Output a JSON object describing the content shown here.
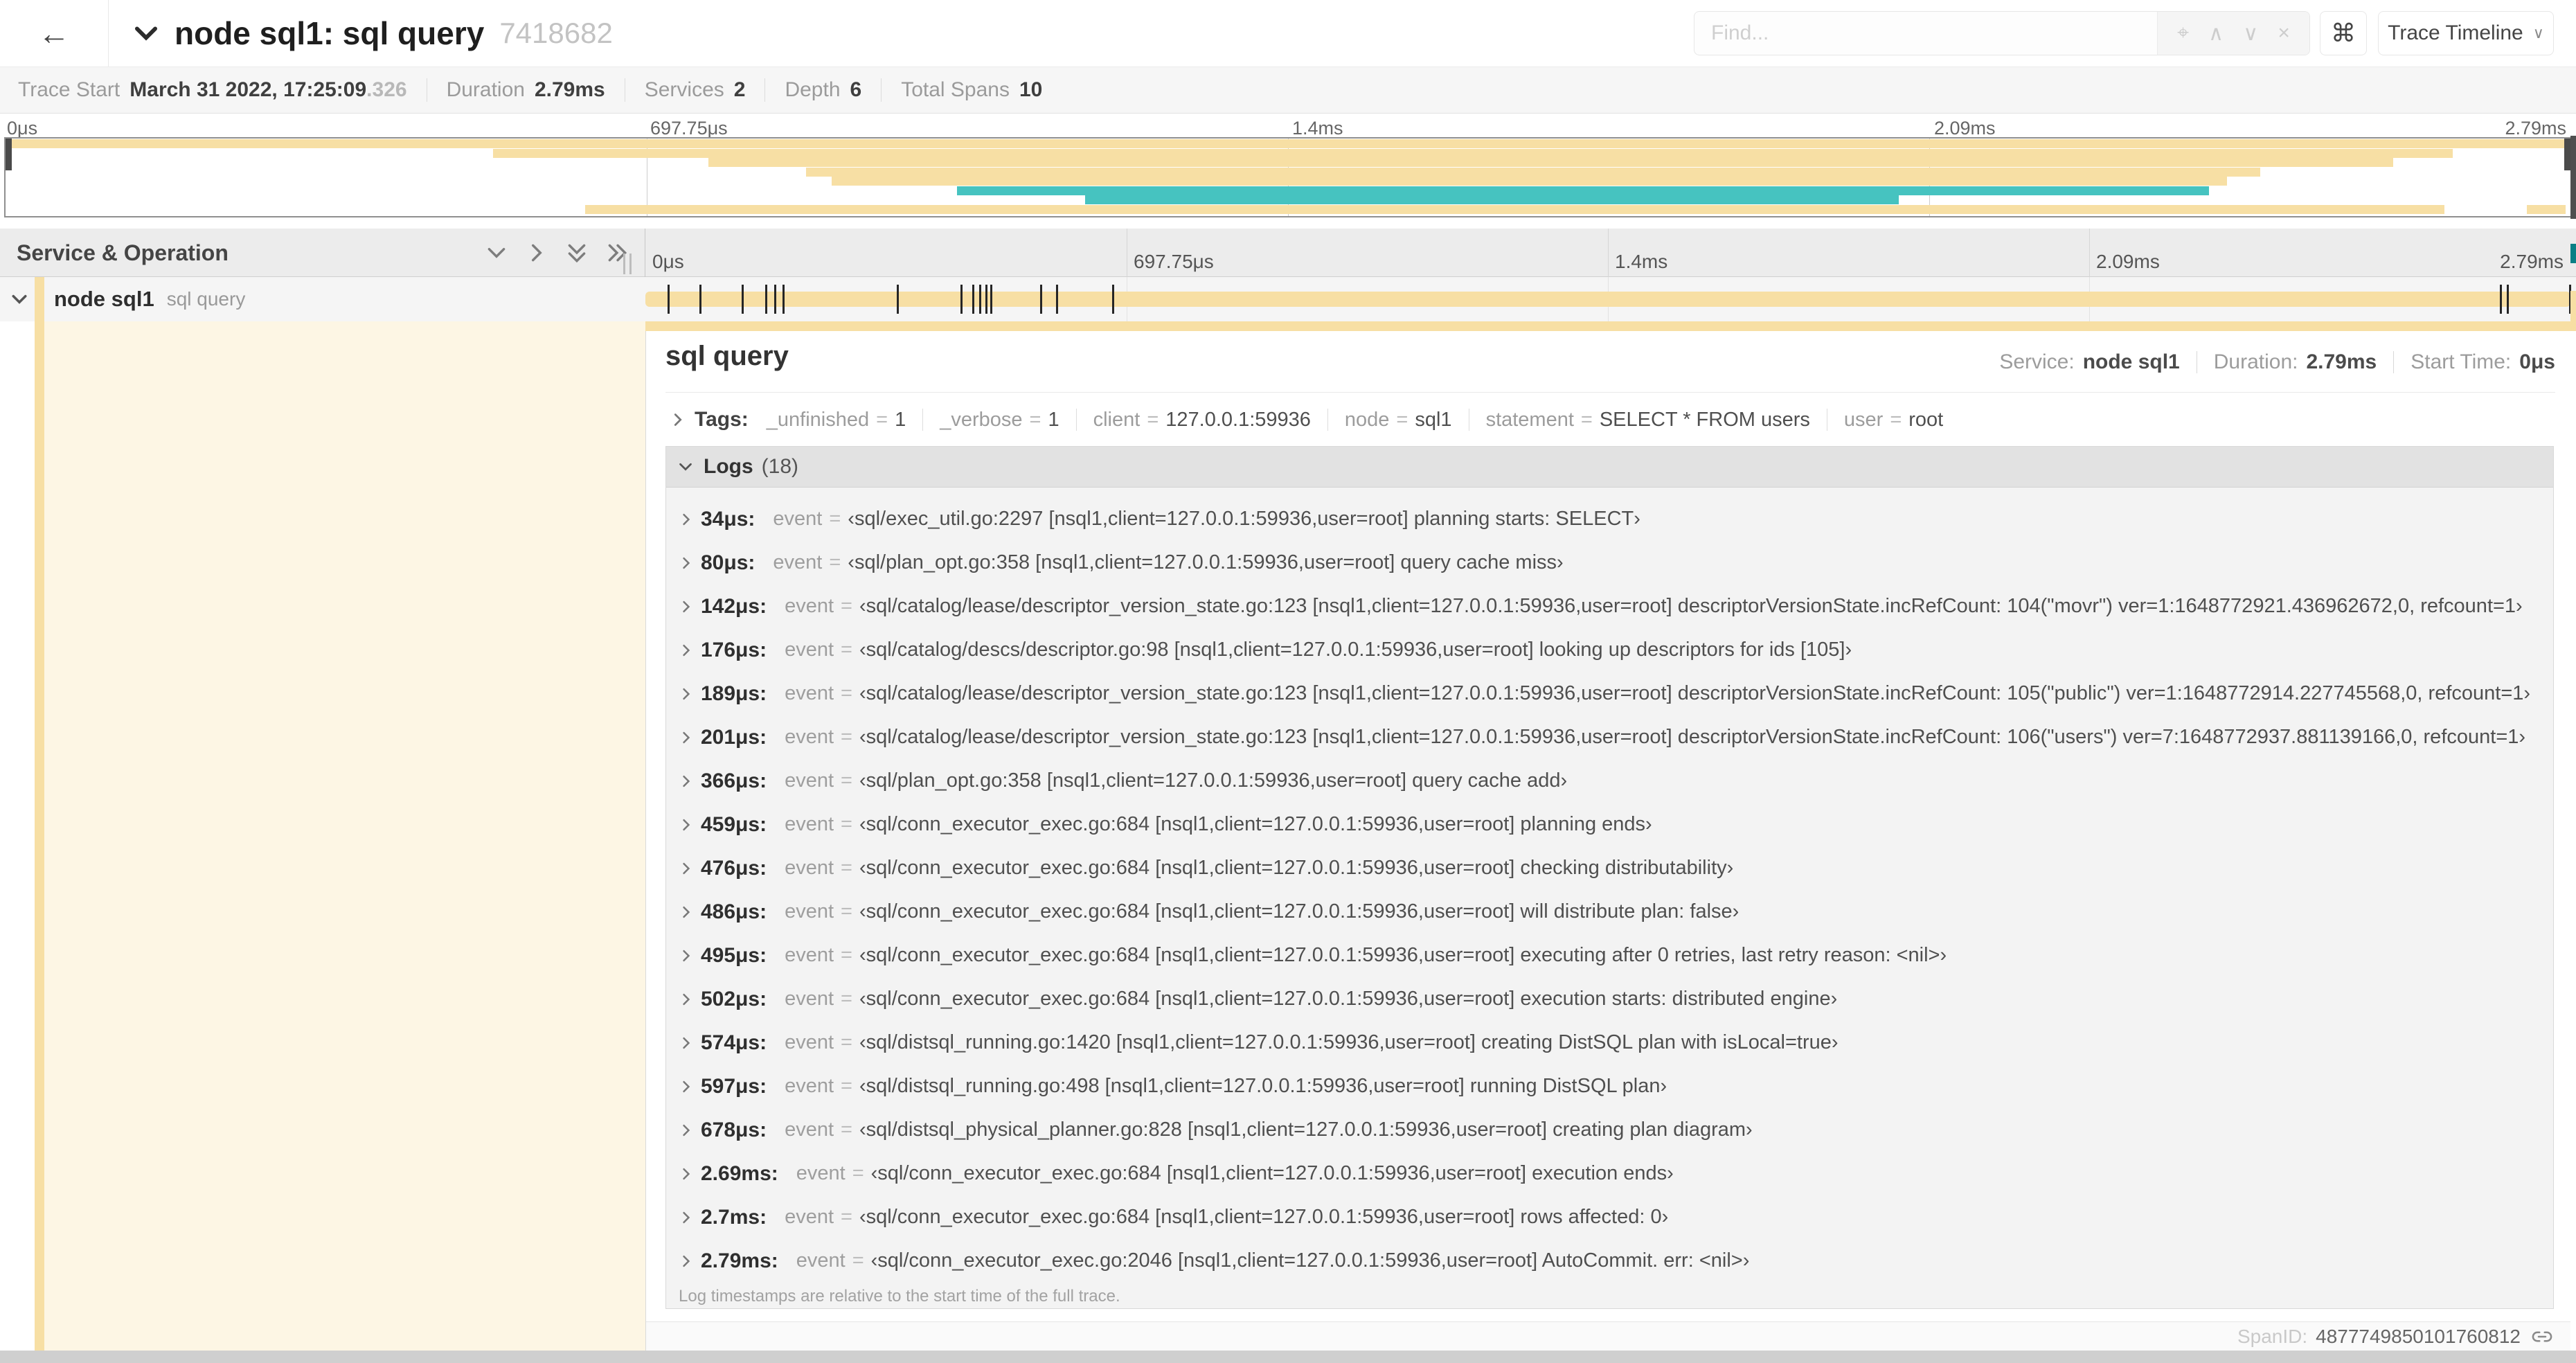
{
  "colors": {
    "tan": "#f7dfa4",
    "teal": "#46c3c0",
    "cream": "#fdf6e4",
    "scrubber": "#4a4a4a",
    "tick": "#262626"
  },
  "header": {
    "back_icon": "←",
    "collapse_icon": "∨",
    "title": "node sql1: sql query",
    "trace_id": "7418682",
    "find_placeholder": "Find...",
    "find_icons": {
      "locate": "⌖",
      "prev": "∧",
      "next": "∨",
      "clear": "×"
    },
    "shortcut_button": "⌘",
    "view_selector": "Trace Timeline",
    "view_selector_chevron": "∨"
  },
  "meta": {
    "items": [
      {
        "label": "Trace Start",
        "value": "March 31 2022, 17:25:09",
        "suffix": ".326"
      },
      {
        "label": "Duration",
        "value": "2.79ms"
      },
      {
        "label": "Services",
        "value": "2"
      },
      {
        "label": "Depth",
        "value": "6"
      },
      {
        "label": "Total Spans",
        "value": "10"
      }
    ]
  },
  "ruler": {
    "labels": [
      "0μs",
      "697.75μs",
      "1.4ms",
      "2.09ms",
      "2.79ms"
    ],
    "fractions": [
      0,
      0.25,
      0.5,
      0.75,
      1
    ]
  },
  "minimap": {
    "bars": [
      {
        "row": 0,
        "start": 0,
        "end": 1,
        "color": "tan"
      },
      {
        "row": 1,
        "start": 0.19,
        "end": 0.954,
        "color": "tan"
      },
      {
        "row": 2,
        "start": 0.274,
        "end": 0.931,
        "color": "tan"
      },
      {
        "row": 3,
        "start": 0.312,
        "end": 0.879,
        "color": "tan"
      },
      {
        "row": 4,
        "start": 0.322,
        "end": 0.866,
        "color": "tan"
      },
      {
        "row": 5,
        "start": 0.371,
        "end": 0.859,
        "color": "teal"
      },
      {
        "row": 6,
        "start": 0.421,
        "end": 0.738,
        "color": "teal"
      },
      {
        "row": 7,
        "start": 0.226,
        "end": 0.951,
        "color": "tan"
      },
      {
        "row": 7,
        "start": 0.983,
        "end": 0.998,
        "color": "tan"
      }
    ]
  },
  "timeline": {
    "left_header": "Service & Operation",
    "row": {
      "service": "node sql1",
      "operation": "sql query",
      "total_us": 2790,
      "tick_times_us": [
        34,
        80,
        142,
        176,
        189,
        201,
        366,
        459,
        476,
        486,
        495,
        502,
        574,
        597,
        678,
        2690,
        2700,
        2790
      ]
    }
  },
  "detail": {
    "title": "sql query",
    "service_label": "Service:",
    "service": "node sql1",
    "duration_label": "Duration:",
    "duration": "2.79ms",
    "start_label": "Start Time:",
    "start": "0μs",
    "tags_label": "Tags:",
    "tags": [
      {
        "key": "_unfinished",
        "value": "1"
      },
      {
        "key": "_verbose",
        "value": "1"
      },
      {
        "key": "client",
        "value": "127.0.0.1:59936"
      },
      {
        "key": "node",
        "value": "sql1"
      },
      {
        "key": "statement",
        "value": "SELECT * FROM users"
      },
      {
        "key": "user",
        "value": "root"
      }
    ],
    "logs_label": "Logs",
    "logs_count": "(18)",
    "logs": [
      {
        "time": "34μs:",
        "field": "event",
        "value": "‹sql/exec_util.go:2297 [nsql1,client=127.0.0.1:59936,user=root] planning starts: SELECT›"
      },
      {
        "time": "80μs:",
        "field": "event",
        "value": "‹sql/plan_opt.go:358 [nsql1,client=127.0.0.1:59936,user=root] query cache miss›"
      },
      {
        "time": "142μs:",
        "field": "event",
        "value": "‹sql/catalog/lease/descriptor_version_state.go:123 [nsql1,client=127.0.0.1:59936,user=root] descriptorVersionState.incRefCount: 104(\"movr\") ver=1:1648772921.436962672,0, refcount=1›"
      },
      {
        "time": "176μs:",
        "field": "event",
        "value": "‹sql/catalog/descs/descriptor.go:98 [nsql1,client=127.0.0.1:59936,user=root] looking up descriptors for ids [105]›"
      },
      {
        "time": "189μs:",
        "field": "event",
        "value": "‹sql/catalog/lease/descriptor_version_state.go:123 [nsql1,client=127.0.0.1:59936,user=root] descriptorVersionState.incRefCount: 105(\"public\") ver=1:1648772914.227745568,0, refcount=1›"
      },
      {
        "time": "201μs:",
        "field": "event",
        "value": "‹sql/catalog/lease/descriptor_version_state.go:123 [nsql1,client=127.0.0.1:59936,user=root] descriptorVersionState.incRefCount: 106(\"users\") ver=7:1648772937.881139166,0, refcount=1›"
      },
      {
        "time": "366μs:",
        "field": "event",
        "value": "‹sql/plan_opt.go:358 [nsql1,client=127.0.0.1:59936,user=root] query cache add›"
      },
      {
        "time": "459μs:",
        "field": "event",
        "value": "‹sql/conn_executor_exec.go:684 [nsql1,client=127.0.0.1:59936,user=root] planning ends›"
      },
      {
        "time": "476μs:",
        "field": "event",
        "value": "‹sql/conn_executor_exec.go:684 [nsql1,client=127.0.0.1:59936,user=root] checking distributability›"
      },
      {
        "time": "486μs:",
        "field": "event",
        "value": "‹sql/conn_executor_exec.go:684 [nsql1,client=127.0.0.1:59936,user=root] will distribute plan: false›"
      },
      {
        "time": "495μs:",
        "field": "event",
        "value": "‹sql/conn_executor_exec.go:684 [nsql1,client=127.0.0.1:59936,user=root] executing after 0 retries, last retry reason: <nil>›"
      },
      {
        "time": "502μs:",
        "field": "event",
        "value": "‹sql/conn_executor_exec.go:684 [nsql1,client=127.0.0.1:59936,user=root] execution starts: distributed engine›"
      },
      {
        "time": "574μs:",
        "field": "event",
        "value": "‹sql/distsql_running.go:1420 [nsql1,client=127.0.0.1:59936,user=root] creating DistSQL plan with isLocal=true›"
      },
      {
        "time": "597μs:",
        "field": "event",
        "value": "‹sql/distsql_running.go:498 [nsql1,client=127.0.0.1:59936,user=root] running DistSQL plan›"
      },
      {
        "time": "678μs:",
        "field": "event",
        "value": "‹sql/distsql_physical_planner.go:828 [nsql1,client=127.0.0.1:59936,user=root] creating plan diagram›"
      },
      {
        "time": "2.69ms:",
        "field": "event",
        "value": "‹sql/conn_executor_exec.go:684 [nsql1,client=127.0.0.1:59936,user=root] execution ends›"
      },
      {
        "time": "2.7ms:",
        "field": "event",
        "value": "‹sql/conn_executor_exec.go:684 [nsql1,client=127.0.0.1:59936,user=root] rows affected: 0›"
      },
      {
        "time": "2.79ms:",
        "field": "event",
        "value": "‹sql/conn_executor_exec.go:2046 [nsql1,client=127.0.0.1:59936,user=root] AutoCommit. err: <nil>›"
      }
    ],
    "logs_note": "Log timestamps are relative to the start time of the full trace.",
    "span_id_label": "SpanID:",
    "span_id": "4877749850101760812"
  }
}
